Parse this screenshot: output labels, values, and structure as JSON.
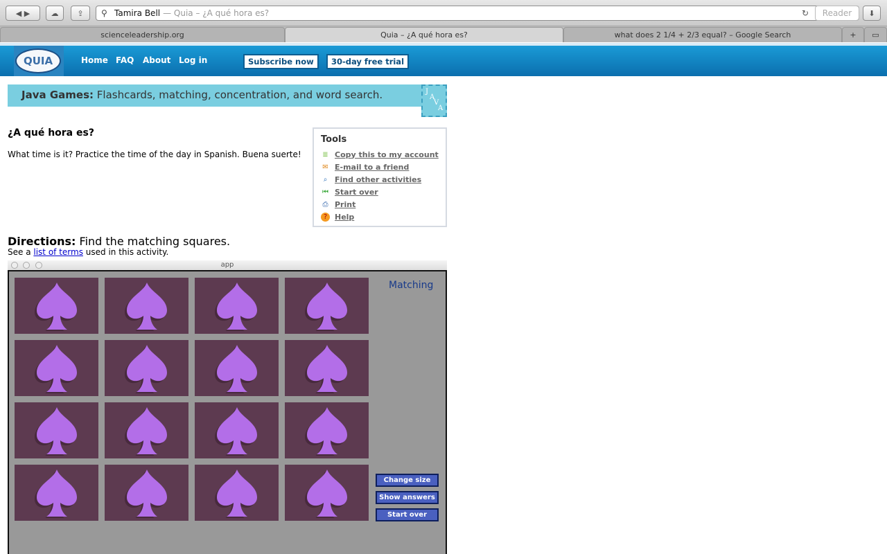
{
  "browser": {
    "address_title": "Tamira Bell",
    "address_subtitle": "— Quia – ¿A qué hora es?",
    "reader_label": "Reader",
    "tabs": [
      {
        "label": "scienceleadership.org"
      },
      {
        "label": "Quia – ¿A qué hora es?"
      },
      {
        "label": "what does 2 1/4 + 2/3 equal? – Google Search"
      }
    ]
  },
  "nav": {
    "logo": "QUIA",
    "links": [
      "Home",
      "FAQ",
      "About",
      "Log in"
    ],
    "subscribe": "Subscribe now",
    "trial": "30-day free trial"
  },
  "banner": {
    "bold": "Java Games:",
    "text": "Flashcards, matching, concentration, and word search.",
    "badge": "JAVA"
  },
  "activity": {
    "title": "¿A qué hora es?",
    "description": "What time is it? Practice the time of the day in Spanish. Buena suerte!"
  },
  "tools": {
    "heading": "Tools",
    "items": [
      {
        "label": "Copy this to my account",
        "icon": "copy-icon",
        "color": "#7cc04a",
        "glyph": "≣"
      },
      {
        "label": "E-mail to a friend",
        "icon": "email-person-icon",
        "color": "#e08a20",
        "glyph": "✉"
      },
      {
        "label": "Find other activities",
        "icon": "search-icon",
        "color": "#2a6fb8",
        "glyph": "⌕"
      },
      {
        "label": "Start over",
        "icon": "rewind-icon",
        "color": "#3aa83a",
        "glyph": "⏮"
      },
      {
        "label": "Print",
        "icon": "printer-icon",
        "color": "#2a5fa8",
        "glyph": "⎙"
      },
      {
        "label": "Help",
        "icon": "help-icon",
        "color": "#f59a20",
        "glyph": "?"
      }
    ]
  },
  "directions": {
    "label": "Directions:",
    "text": "Find the matching squares.",
    "see_prefix": "See a",
    "see_link": "list of terms",
    "see_suffix": "used in this activity."
  },
  "app": {
    "window_title": "app",
    "game_title": "Matching",
    "card_rows": 4,
    "card_cols": 4,
    "card_color": "#5d3a50",
    "spade_color": "#b36ee8",
    "buttons": [
      "Change size",
      "Show answers",
      "Start over"
    ]
  }
}
